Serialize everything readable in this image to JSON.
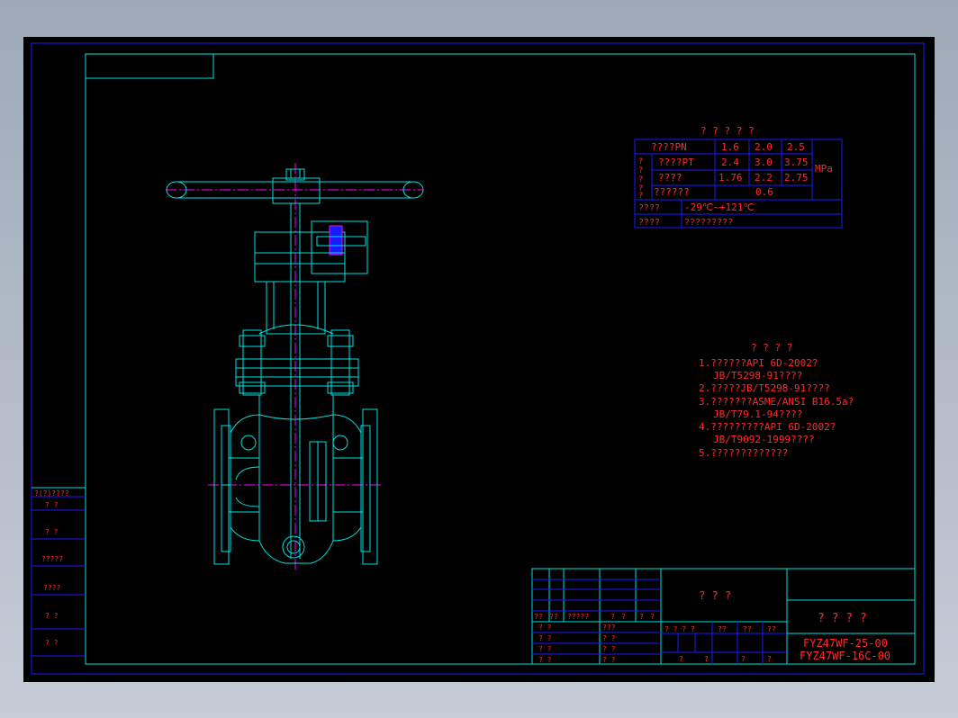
{
  "colors": {
    "background": "#000000",
    "frame": "#00e0e0",
    "table_lines": "#1a1aff",
    "text": "#ff2a2a",
    "centerline": "#ff00ff"
  },
  "params": {
    "title": "? ? ? ? ?",
    "rows": [
      {
        "label": "????PN",
        "v1": "1.6",
        "v2": "2.0",
        "v3": "2.5"
      },
      {
        "label": "????PT",
        "v1": "2.4",
        "v2": "3.0",
        "v3": "3.75"
      },
      {
        "label": "????",
        "v1": "1.76",
        "v2": "2.2",
        "v3": "2.75"
      },
      {
        "label": "??????",
        "v1": "0.6"
      }
    ],
    "side_chars": [
      "?",
      "?",
      "?",
      "?",
      "?"
    ],
    "unit": "MPa",
    "temp_label": "????",
    "temp_value": "-29℃~+121℃",
    "medium_label": "????",
    "medium_value": "?????????"
  },
  "notes": {
    "title": "? ? ? ?",
    "lines": [
      "1.??????API 6D-2002?",
      "JB/T5298-91????",
      "2.?????JB/T5298-91????",
      "3.???????ASME/ANSI B16.5a?",
      "JB/T79.1-94????",
      "4.?????????API 6D-2002?",
      "JB/T9092-1999????",
      "5.?????????????"
    ]
  },
  "left_strip": {
    "header": "?(?)????",
    "labels": [
      "?   ?",
      "?   ?",
      "?????",
      "????",
      "?   ?",
      "?   ?"
    ]
  },
  "title_block": {
    "rev_row": [
      "??",
      "??",
      "?????",
      "?",
      "?",
      "?",
      "?"
    ],
    "sign_rows": [
      {
        "a": "? ?",
        "b": "???"
      },
      {
        "a": "? ?",
        "b": "? ?"
      },
      {
        "a": "? ?",
        "b": "? ?"
      },
      {
        "a": "? ?",
        "b": "? ?"
      }
    ],
    "material": "? ? ?",
    "stage_headers": [
      "? ? ? ?",
      "??",
      "??",
      "??"
    ],
    "stage_bottom": [
      "?",
      "?",
      "?",
      "?"
    ],
    "name": "? ? ? ?",
    "drawing_no_1": "FYZ47WF-25-00",
    "drawing_no_2": "FYZ47WF-16C-00"
  }
}
